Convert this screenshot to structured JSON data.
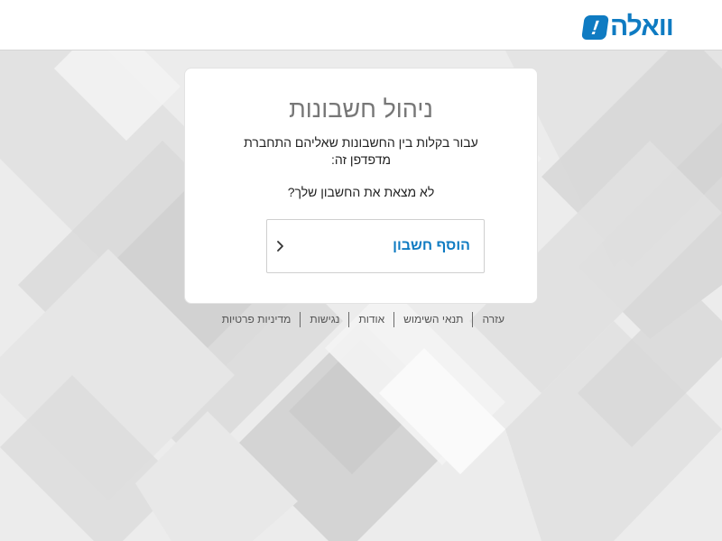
{
  "brand": {
    "logo_text": "וואלה",
    "logo_mark": "!",
    "color": "#0f7bc2"
  },
  "card": {
    "title": "ניהול חשבונות",
    "description_line1": "עבור בקלות בין החשבונות שאליהם התחברת",
    "description_line2": "מדפדפן זה:",
    "question": "לא מצאת את החשבון שלך?",
    "add_account_label": "הוסף חשבון"
  },
  "footer": {
    "links": [
      "עזרה",
      "תנאי השימוש",
      "אודות",
      "נגישות",
      "מדיניות פרטיות"
    ]
  },
  "icons": {
    "add_account_arrow": "chevron-left-icon"
  }
}
